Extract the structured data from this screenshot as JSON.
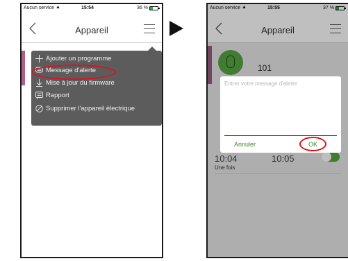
{
  "left_screen": {
    "status": {
      "carrier": "Aucun service",
      "time": "15:54",
      "battery": "36 %"
    },
    "title": "Appareil",
    "menu": [
      {
        "label": "Ajouter un programme",
        "icon": "plus-icon"
      },
      {
        "label": "Message d'alerte",
        "icon": "chat-bubble-icon"
      },
      {
        "label": "Mise à jour du firmware",
        "icon": "download-arrow-icon"
      },
      {
        "label": "Rapport",
        "icon": "report-icon"
      },
      {
        "label": "Supprimer l'appareil électrique",
        "icon": "prohibited-icon"
      }
    ]
  },
  "right_screen": {
    "status": {
      "carrier": "Aucun service",
      "time": "15:55",
      "battery": "37 %"
    },
    "title": "Appareil",
    "device_name": "101",
    "schedule": {
      "time_start": "10:04",
      "time_end": "10:05",
      "frequency": "Une fois"
    },
    "dialog": {
      "placeholder": "Entrer votre message d'alerte",
      "cancel_label": "Annuler",
      "ok_label": "OK"
    }
  },
  "colors": {
    "accent_green": "#58a443",
    "highlight_red": "#e0101c",
    "menu_bg": "#5c5c5c",
    "device_strip": "#9b5c80"
  }
}
